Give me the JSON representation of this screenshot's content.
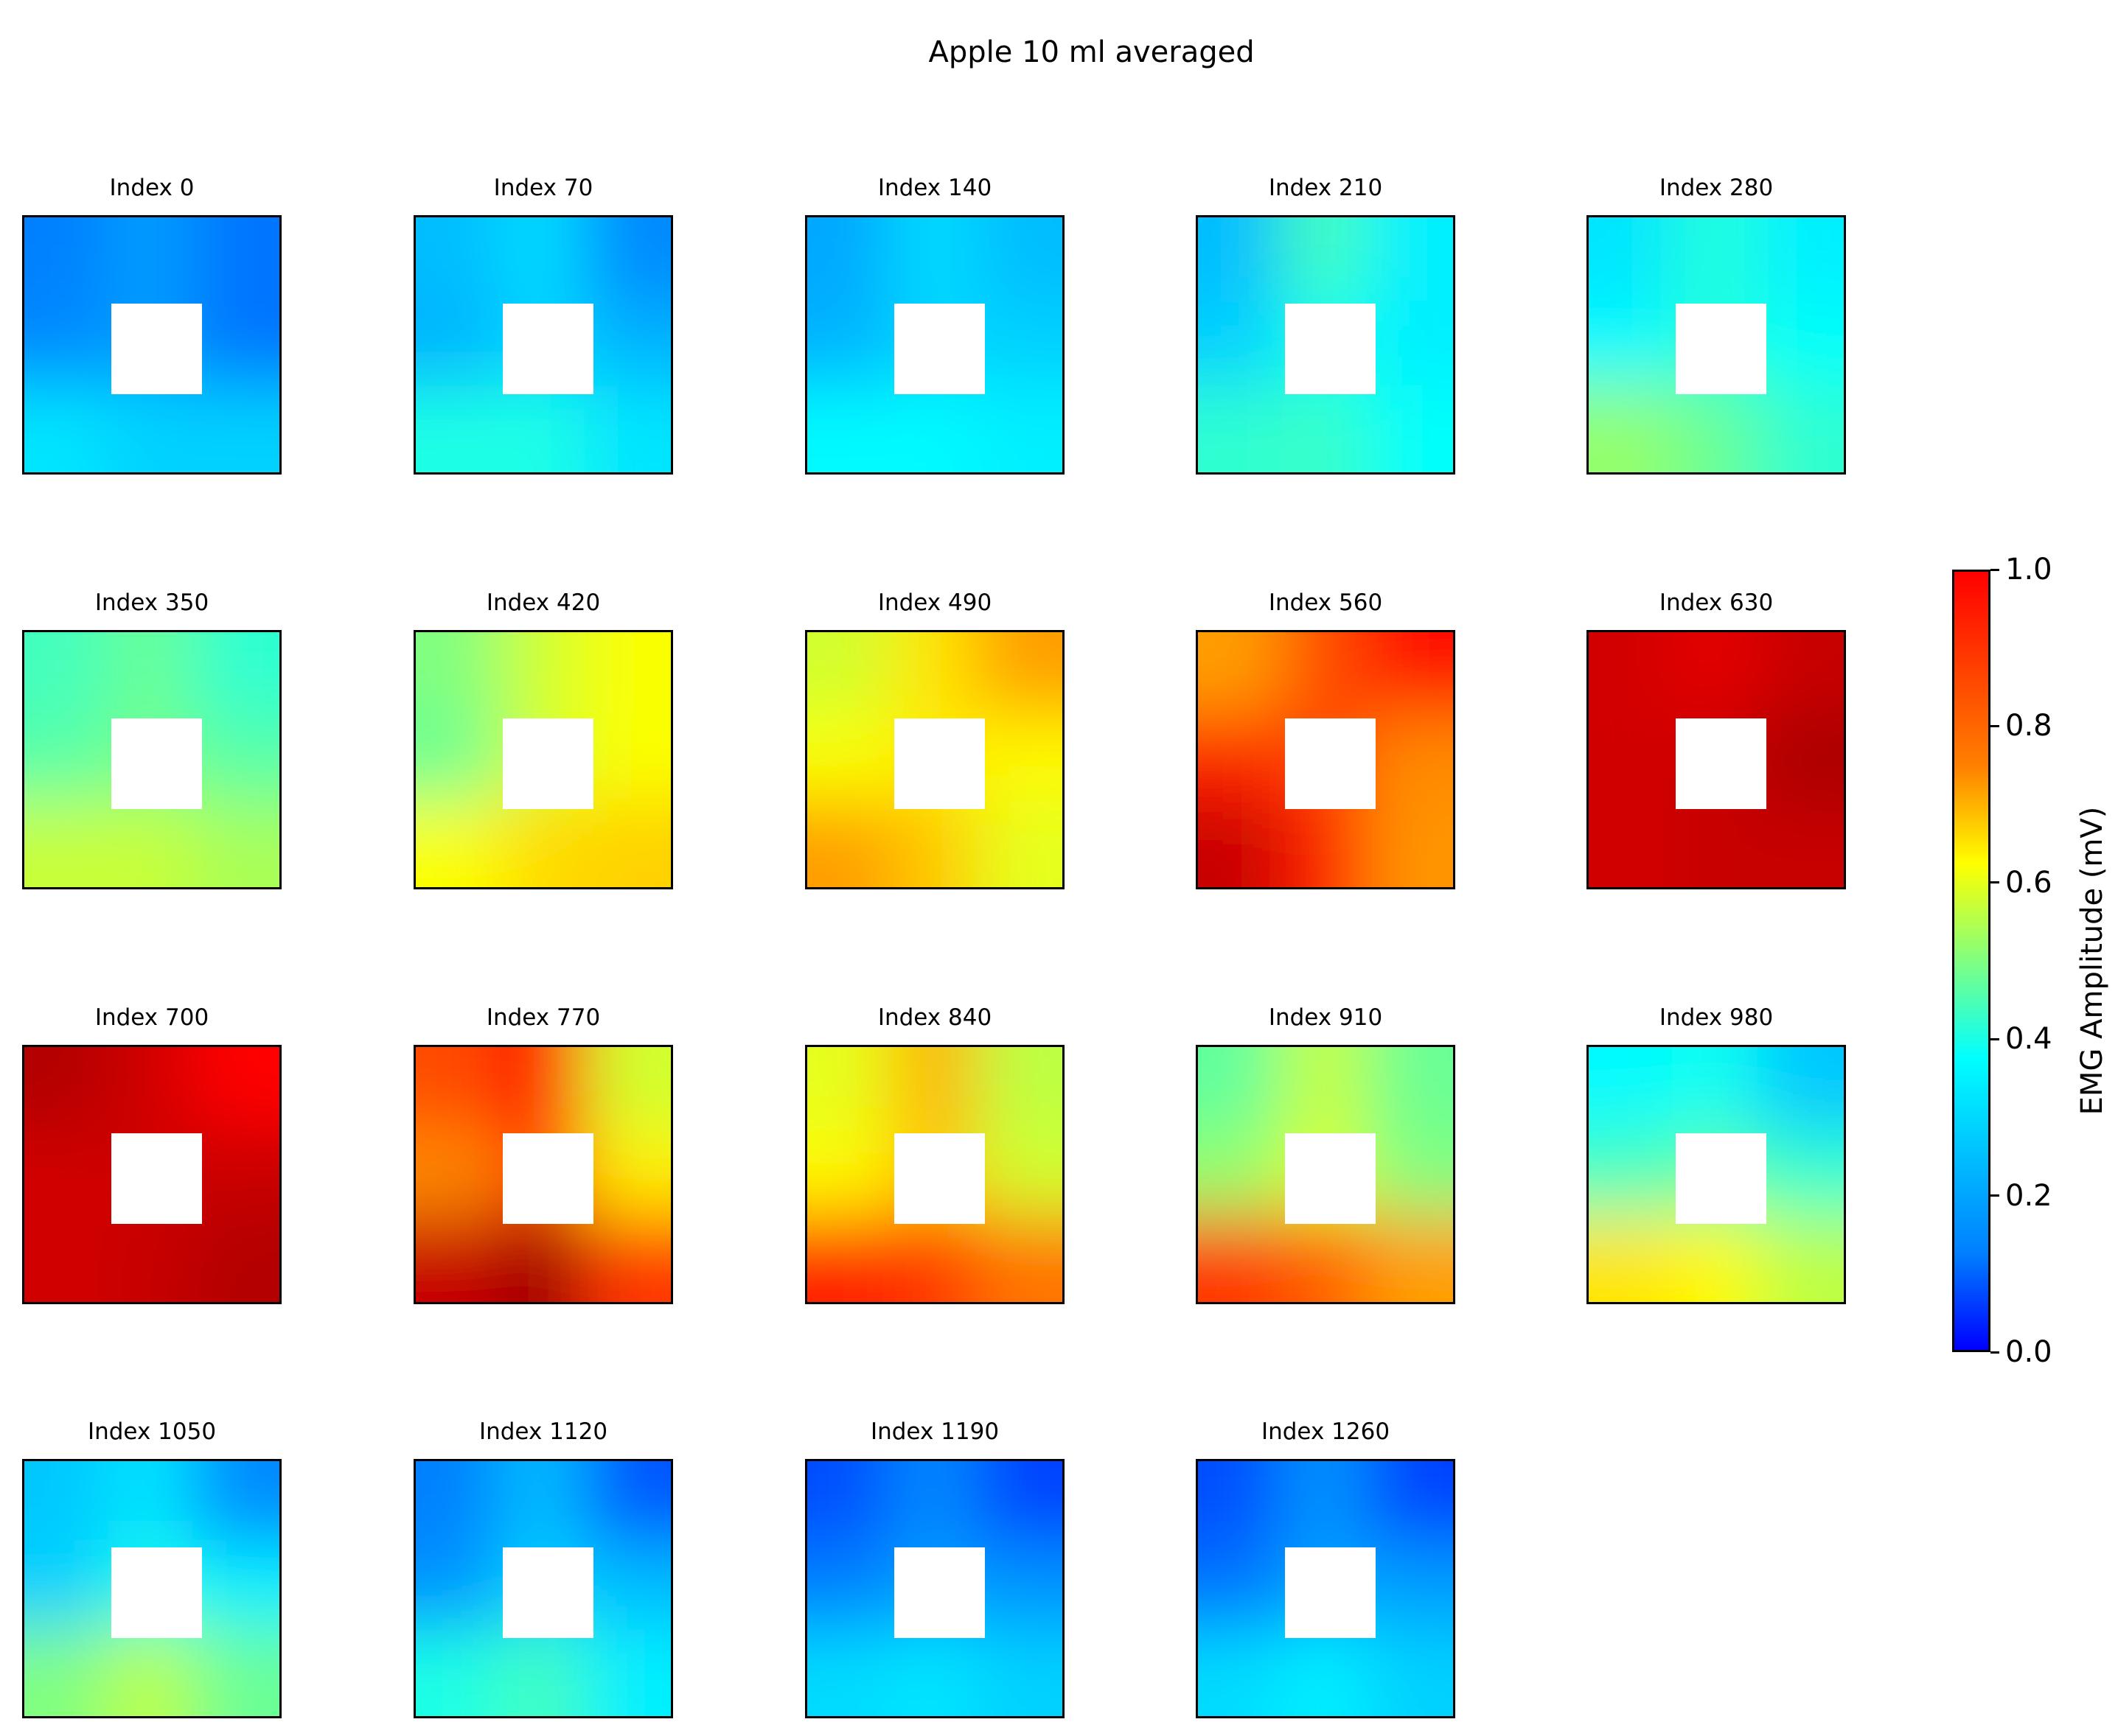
{
  "chart_data": {
    "type": "heatmap",
    "title": "Apple 10 ml averaged",
    "layout": {
      "rows": 4,
      "cols": 5
    },
    "colormap": "jet",
    "colorbar": {
      "label": "EMG Amplitude (mV)",
      "range": [
        0.0,
        1.0
      ],
      "ticks": [
        "0.0",
        "0.2",
        "0.4",
        "0.6",
        "0.8",
        "1.0"
      ]
    },
    "panels": [
      {
        "title": "Index 0",
        "grid": [
          [
            0.25,
            0.28,
            0.24
          ],
          [
            0.26,
            null,
            0.24
          ],
          [
            0.35,
            0.33,
            0.33
          ]
        ]
      },
      {
        "title": "Index 70",
        "grid": [
          [
            0.31,
            0.34,
            0.26
          ],
          [
            0.3,
            null,
            0.3
          ],
          [
            0.4,
            0.4,
            0.35
          ]
        ]
      },
      {
        "title": "Index 140",
        "grid": [
          [
            0.29,
            0.34,
            0.31
          ],
          [
            0.3,
            null,
            0.33
          ],
          [
            0.37,
            0.37,
            0.36
          ]
        ]
      },
      {
        "title": "Index 210",
        "grid": [
          [
            0.31,
            0.44,
            0.36
          ],
          [
            0.33,
            null,
            0.36
          ],
          [
            0.42,
            0.43,
            0.38
          ]
        ]
      },
      {
        "title": "Index 280",
        "grid": [
          [
            0.35,
            0.41,
            0.36
          ],
          [
            0.37,
            null,
            0.38
          ],
          [
            0.52,
            0.48,
            0.42
          ]
        ]
      },
      {
        "title": "Index 350",
        "grid": [
          [
            0.44,
            0.48,
            0.42
          ],
          [
            0.46,
            null,
            0.46
          ],
          [
            0.57,
            0.57,
            0.54
          ]
        ]
      },
      {
        "title": "Index 420",
        "grid": [
          [
            0.5,
            0.58,
            0.62
          ],
          [
            0.48,
            null,
            0.62
          ],
          [
            0.62,
            0.66,
            0.67
          ]
        ]
      },
      {
        "title": "Index 490",
        "grid": [
          [
            0.58,
            0.65,
            0.72
          ],
          [
            0.62,
            null,
            0.63
          ],
          [
            0.72,
            0.68,
            0.6
          ]
        ]
      },
      {
        "title": "Index 560",
        "grid": [
          [
            0.72,
            0.8,
            0.86
          ],
          [
            0.84,
            null,
            0.74
          ],
          [
            0.93,
            0.84,
            0.73
          ]
        ]
      },
      {
        "title": "Index 630",
        "grid": [
          [
            0.92,
            0.9,
            0.93
          ],
          [
            0.92,
            null,
            0.96
          ],
          [
            0.92,
            0.93,
            0.93
          ]
        ]
      },
      {
        "title": "Index 700",
        "grid": [
          [
            0.95,
            0.92,
            0.87
          ],
          [
            0.92,
            null,
            0.93
          ],
          [
            0.92,
            0.93,
            0.95
          ]
        ]
      },
      {
        "title": "Index 770",
        "grid": [
          [
            0.8,
            0.87,
            0.58
          ],
          [
            0.74,
            null,
            0.64
          ],
          [
            0.93,
            0.97,
            0.82
          ]
        ]
      },
      {
        "title": "Index 840",
        "grid": [
          [
            0.6,
            0.7,
            0.56
          ],
          [
            0.63,
            null,
            0.58
          ],
          [
            0.84,
            0.82,
            0.76
          ]
        ]
      },
      {
        "title": "Index 910",
        "grid": [
          [
            0.47,
            0.57,
            0.48
          ],
          [
            0.52,
            null,
            0.5
          ],
          [
            0.82,
            0.78,
            0.72
          ]
        ]
      },
      {
        "title": "Index 980",
        "grid": [
          [
            0.37,
            0.39,
            0.32
          ],
          [
            0.44,
            null,
            0.42
          ],
          [
            0.65,
            0.63,
            0.56
          ]
        ]
      },
      {
        "title": "Index 1050",
        "grid": [
          [
            0.32,
            0.35,
            0.26
          ],
          [
            0.33,
            null,
            0.36
          ],
          [
            0.5,
            0.56,
            0.48
          ]
        ]
      },
      {
        "title": "Index 1120",
        "grid": [
          [
            0.25,
            0.31,
            0.21
          ],
          [
            0.27,
            null,
            0.31
          ],
          [
            0.4,
            0.44,
            0.36
          ]
        ]
      },
      {
        "title": "Index 1190",
        "grid": [
          [
            0.2,
            0.26,
            0.19
          ],
          [
            0.25,
            null,
            0.27
          ],
          [
            0.34,
            0.35,
            0.33
          ]
        ]
      },
      {
        "title": "Index 1260",
        "grid": [
          [
            0.2,
            0.27,
            0.19
          ],
          [
            0.24,
            null,
            0.28
          ],
          [
            0.34,
            0.36,
            0.33
          ]
        ]
      }
    ]
  }
}
